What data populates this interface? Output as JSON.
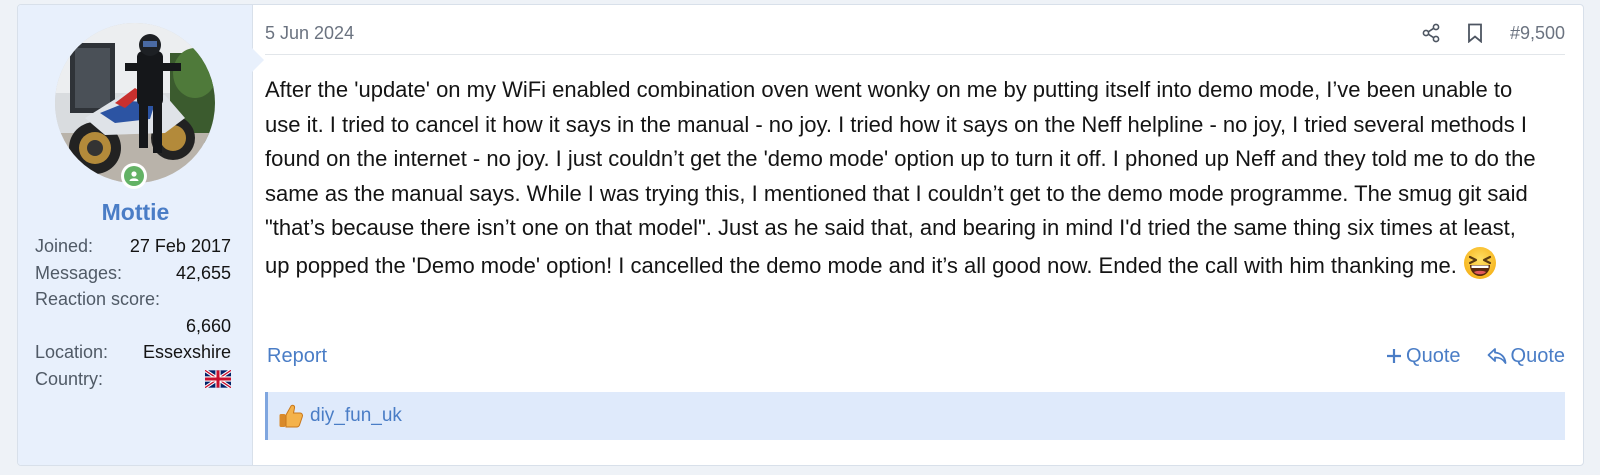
{
  "user": {
    "username": "Mottie",
    "stats": {
      "joined_label": "Joined:",
      "joined_value": "27 Feb 2017",
      "messages_label": "Messages:",
      "messages_value": "42,655",
      "reaction_label": "Reaction score:",
      "reaction_value": "6,660",
      "location_label": "Location:",
      "location_value": "Essexshire",
      "country_label": "Country:",
      "country_flag": "uk-flag-icon"
    },
    "online_status": "online"
  },
  "post": {
    "date": "5 Jun 2024",
    "number": "#9,500",
    "body": "After the 'update' on my WiFi enabled combination oven went wonky on me by putting itself into demo mode, I’ve been unable to use it. I tried to cancel it how it says in the manual - no joy. I tried how it says on the Neff helpline - no joy, I tried several methods I found on the internet - no joy. I just couldn’t get the 'demo mode' option up to turn it off. I phoned up Neff and they told me to do the same as the manual says. While I was trying this, I mentioned that I couldn’t get to the demo mode programme. The smug git said \"that’s because there isn’t one on that model\". Just as he said that, and bearing in mind I'd tried the same thing six times at least, up popped the 'Demo mode' option! I cancelled the demo mode and it’s all good now. Ended the call with him thanking me.",
    "emoji": "laughing-face-icon"
  },
  "actions": {
    "report": "Report",
    "multi_quote": "Quote",
    "quote": "Quote"
  },
  "reactions": {
    "icon": "thumbs-up-icon",
    "users": "diy_fun_uk"
  },
  "colors": {
    "accent": "#4a7dc6",
    "user_cell_bg": "#e8f0fc",
    "reaction_bg": "#dfeafb",
    "online": "#63b265"
  }
}
